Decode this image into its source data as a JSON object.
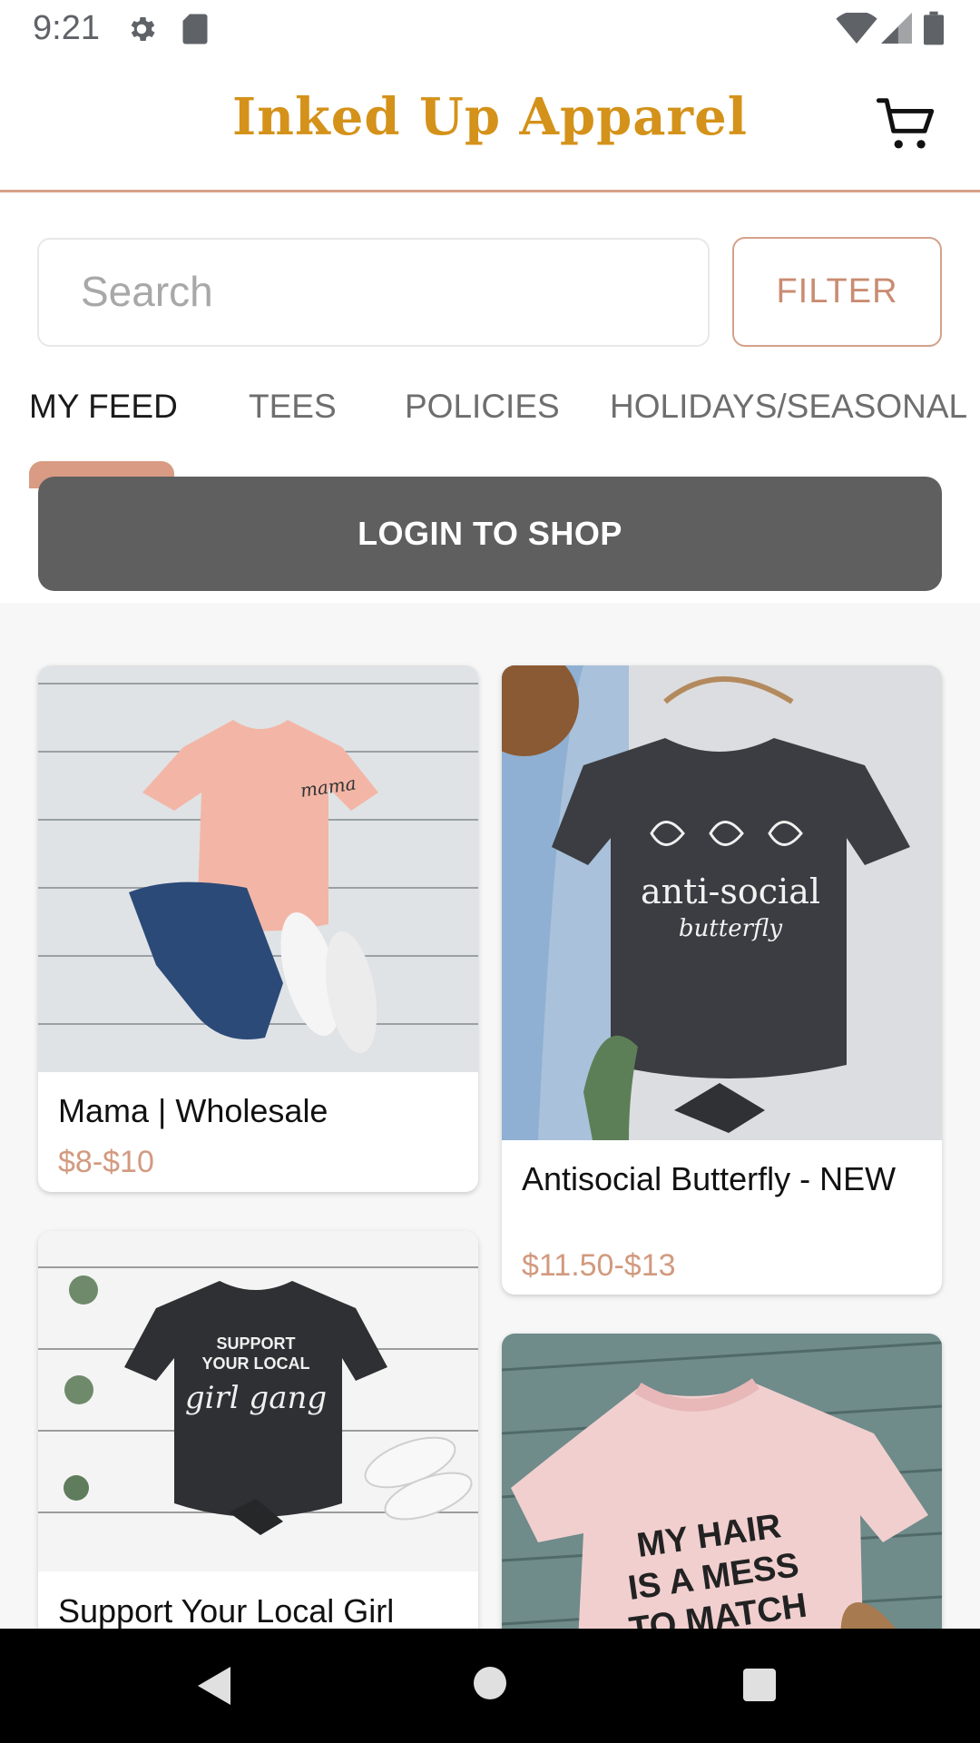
{
  "status_bar": {
    "time": "9:21"
  },
  "header": {
    "brand": "Inked Up Apparel"
  },
  "search": {
    "placeholder": "Search",
    "filter_label": "FILTER"
  },
  "tabs": [
    {
      "label": "MY FEED"
    },
    {
      "label": "TEES"
    },
    {
      "label": "POLICIES"
    },
    {
      "label": "HOLIDAYS/SEASONAL"
    }
  ],
  "login_label": "LOGIN TO SHOP",
  "products": [
    {
      "title": "Mama | Wholesale",
      "price": "$8-$10",
      "shirt_text": "mama"
    },
    {
      "title": "Antisocial Butterfly - NEW",
      "price": "$11.50-$13",
      "shirt_text_1": "anti-social",
      "shirt_text_2": "butterfly"
    },
    {
      "title": "Support Your Local Girl",
      "price": "",
      "shirt_text_1": "SUPPORT",
      "shirt_text_2": "YOUR LOCAL",
      "shirt_text_3": "girl gang"
    },
    {
      "title": "",
      "price": "",
      "shirt_text_1": "MY HAIR",
      "shirt_text_2": "IS A MESS",
      "shirt_text_3": "TO MATCH"
    }
  ],
  "colors": {
    "brand": "#d4921a",
    "accent": "#d4a18a",
    "login_bg": "#5f5f5f"
  }
}
